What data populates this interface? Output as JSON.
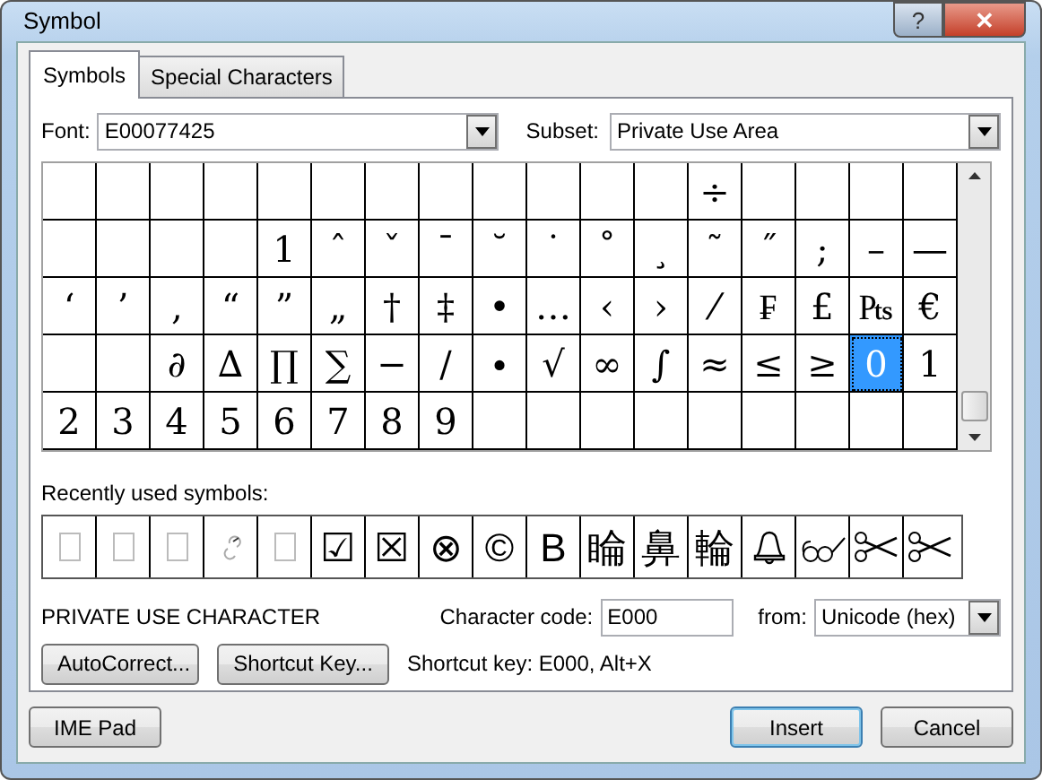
{
  "window": {
    "title": "Symbol",
    "help_button": "?",
    "close_button": "✕"
  },
  "tabs": [
    {
      "label": "Symbols",
      "selected": true
    },
    {
      "label": "Special Characters",
      "selected": false
    }
  ],
  "font": {
    "label": "Font:",
    "value": "E00077425"
  },
  "subset": {
    "label": "Subset:",
    "value": "Private Use Area"
  },
  "symbol_grid": {
    "rows": [
      [
        "",
        "",
        "",
        "",
        "",
        "",
        "",
        "",
        "",
        "",
        "",
        "",
        "÷",
        "",
        "",
        "",
        ""
      ],
      [
        "",
        "",
        "",
        "",
        "1",
        "ˆ",
        "ˇ",
        "¯",
        "˘",
        "˙",
        "˚",
        "¸",
        "˜",
        "˝",
        ";",
        "–",
        "—"
      ],
      [
        "‘",
        "’",
        "‚",
        "“",
        "”",
        "„",
        "†",
        "‡",
        "•",
        "…",
        "‹",
        "›",
        "⁄",
        "₣",
        "£",
        "₧",
        "€"
      ],
      [
        "",
        "",
        "∂",
        "∆",
        "∏",
        "∑",
        "−",
        "∕",
        "∙",
        "√",
        "∞",
        "∫",
        "≈",
        "≤",
        "≥",
        {
          "text": "0",
          "selected": true
        },
        "1"
      ],
      [
        "2",
        "3",
        "4",
        "5",
        "6",
        "7",
        "8",
        "9",
        "",
        "",
        "",
        "",
        "",
        "",
        "",
        "",
        ""
      ]
    ]
  },
  "recent": {
    "label": "Recently used symbols:",
    "items": [
      {
        "kind": "missing"
      },
      {
        "kind": "missing"
      },
      {
        "kind": "missing"
      },
      {
        "kind": "hook"
      },
      {
        "kind": "missing"
      },
      {
        "kind": "text",
        "text": "☑"
      },
      {
        "kind": "text",
        "text": "☒"
      },
      {
        "kind": "text",
        "text": "⊗"
      },
      {
        "kind": "text",
        "text": "©"
      },
      {
        "kind": "text",
        "text": "B"
      },
      {
        "kind": "text",
        "text": "睔"
      },
      {
        "kind": "text",
        "text": "鼻"
      },
      {
        "kind": "text",
        "text": "輪"
      },
      {
        "kind": "bell"
      },
      {
        "kind": "glasses"
      },
      {
        "kind": "scissors"
      },
      {
        "kind": "scissors"
      }
    ]
  },
  "character_name": "PRIVATE USE CHARACTER",
  "character_code": {
    "label": "Character code:",
    "value": "E000"
  },
  "from": {
    "label": "from:",
    "value": "Unicode (hex)"
  },
  "buttons": {
    "autocorrect": "AutoCorrect...",
    "shortcut_key": "Shortcut Key...",
    "shortcut_text": "Shortcut key: E000, Alt+X",
    "ime_pad": "IME Pad",
    "insert": "Insert",
    "cancel": "Cancel"
  }
}
